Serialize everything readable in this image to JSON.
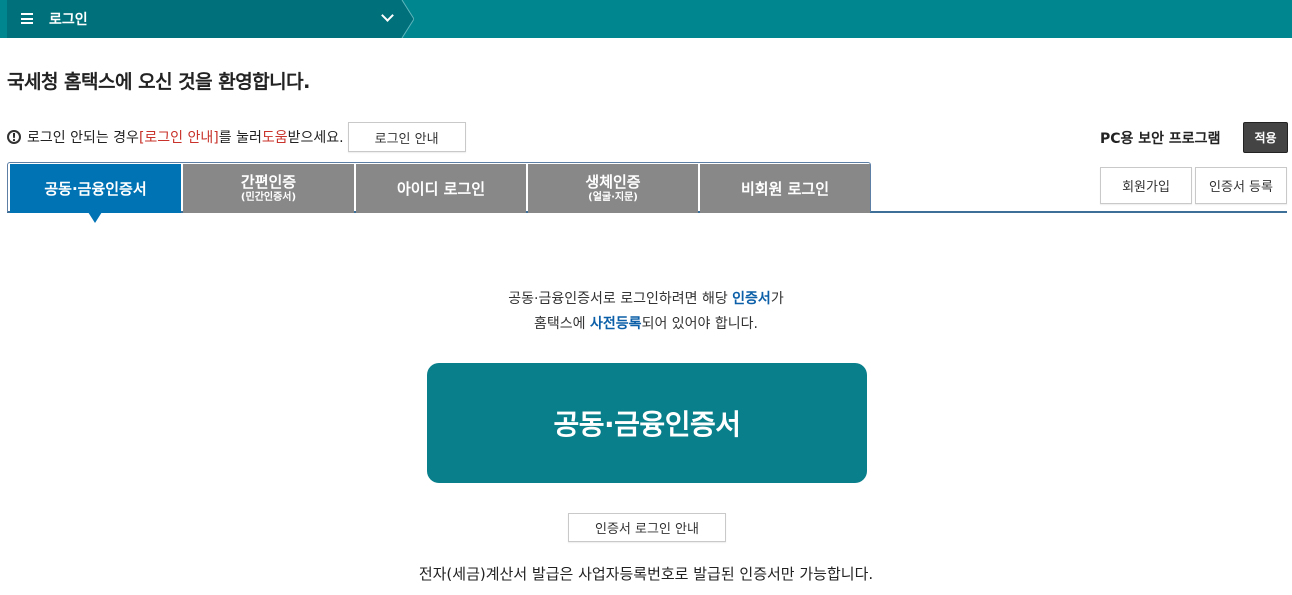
{
  "topbar": {
    "menu_title": "로그인"
  },
  "welcome": "국세청 홈택스에 오신 것을 환영합니다.",
  "help": {
    "text1": "로그인 안되는 경우 ",
    "link_text": "[로그인 안내]",
    "text2": "를 눌러 ",
    "help_word": "도움",
    "text3": "받으세요.",
    "button_label": "로그인 안내"
  },
  "security": {
    "label": "PC용 보안 프로그램",
    "apply_label": "적용"
  },
  "tabs": [
    {
      "label": "공동·금융인증서",
      "sub": "",
      "active": true
    },
    {
      "label": "간편인증",
      "sub": "(민간인증서)",
      "active": false
    },
    {
      "label": "아이디 로그인",
      "sub": "",
      "active": false
    },
    {
      "label": "생체인증",
      "sub": "(얼굴·지문)",
      "active": false
    },
    {
      "label": "비회원 로그인",
      "sub": "",
      "active": false
    }
  ],
  "side_buttons": {
    "signup": "회원가입",
    "cert_register": "인증서 등록"
  },
  "description": {
    "line1_a": "공동·금융인증서로 로그인하려면 해당 ",
    "line1_b": "인증서",
    "line1_c": "가",
    "line2_a": "홈택스에 ",
    "line2_b": "사전등록",
    "line2_c": "되어 있어야 합니다."
  },
  "cert_button": "공동·금융인증서",
  "cert_guide_button": "인증서 로그인 안내",
  "footnote": "전자(세금)계산서 발급은 사업자등록번호로 발급된 인증서만 가능합니다.",
  "colors": {
    "topbar": "#00868f",
    "tab_active": "#0073b5",
    "tab_inactive": "#888888",
    "cert_button": "#087f8b",
    "accent_red": "#c8322a",
    "accent_blue": "#0b5fa8"
  }
}
